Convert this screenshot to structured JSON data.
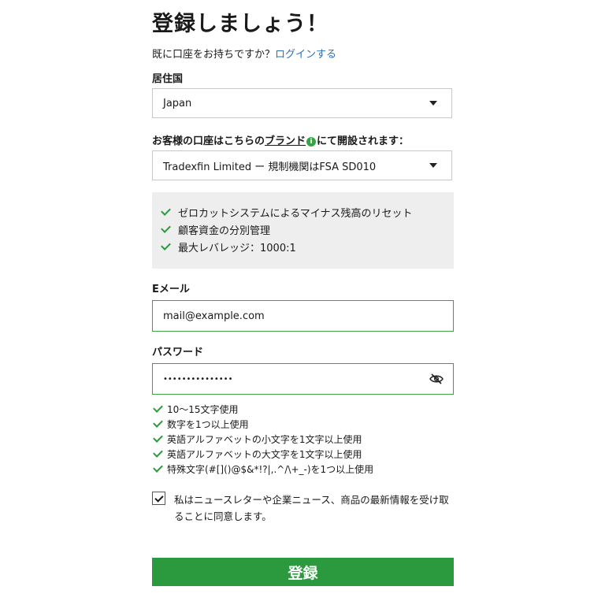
{
  "title": "登録しましょう！",
  "login_prompt": {
    "text": "既に口座をお持ちですか？",
    "link": "ログインする"
  },
  "residence": {
    "label": "居住国",
    "value": "Japan"
  },
  "brand": {
    "text_before": "お客様の口座はこちらの",
    "link": "ブランド",
    "icon_glyph": "i",
    "text_after": "にて開設されます：",
    "value": "Tradexfin Limited ー 規制機関はFSA SD010"
  },
  "features": [
    "ゼロカットシステムによるマイナス残高のリセット",
    "顧客資金の分別管理",
    "最大レバレッジ：1000:1"
  ],
  "email": {
    "label": "Eメール",
    "value": "mail@example.com"
  },
  "password": {
    "label": "パスワード",
    "value": "•••••••••••••••"
  },
  "password_rules": [
    "10〜15文字使用",
    "数字を1つ以上使用",
    "英語アルファベットの小文字を1文字以上使用",
    "英語アルファベットの大文字を1文字以上使用",
    "特殊文字(#[]()@$&*!?|,.^/\\+_-)を1つ以上使用"
  ],
  "newsletter": {
    "checked": true,
    "text": "私はニュースレターや企業ニュース、商品の最新情報を受け取ることに同意します。"
  },
  "submit_label": "登録",
  "colors": {
    "accent": "#2b9a3e",
    "link": "#2a6fb8"
  }
}
